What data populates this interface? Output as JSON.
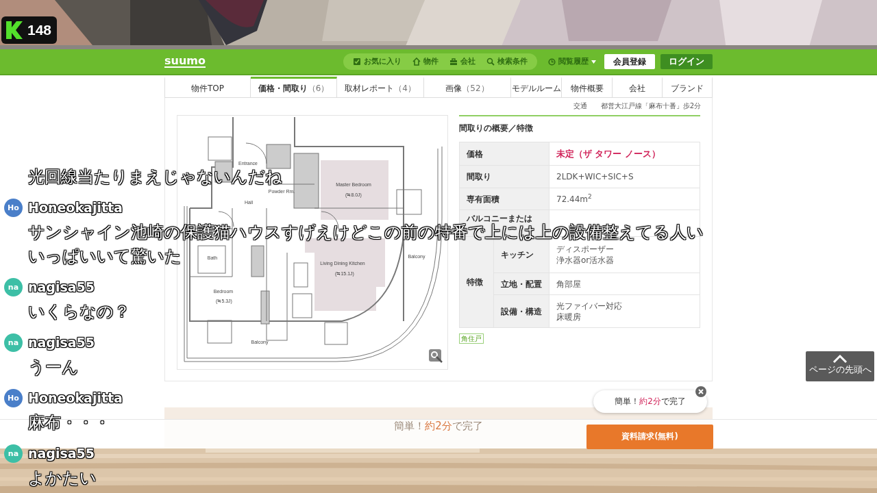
{
  "stream_badge": {
    "count": "148"
  },
  "header": {
    "logo": "suumo",
    "nav": [
      {
        "label": "お気に入り"
      },
      {
        "label": "物件"
      },
      {
        "label": "会社"
      },
      {
        "label": "検索条件"
      }
    ],
    "history": "閲覧履歴",
    "register": "会員登録",
    "login": "ログイン"
  },
  "tabs": [
    {
      "label": "物件TOP",
      "selected": false
    },
    {
      "label": "価格・間取り",
      "count": "（6）",
      "selected": true
    },
    {
      "label": "取材レポート",
      "count": "（4）",
      "selected": false
    },
    {
      "label": "画像",
      "count": "（52）",
      "selected": false
    },
    {
      "label": "モデルルーム",
      "selected": false
    },
    {
      "label": "物件概要",
      "selected": false
    },
    {
      "label": "会社",
      "selected": false
    },
    {
      "label": "ブランド",
      "selected": false
    }
  ],
  "transit": {
    "label": "交通",
    "value": "都営大江戸線「麻布十番」歩2分"
  },
  "floor_plan": {
    "labels": [
      "Master Bedroom",
      "(≒8.0J)",
      "Living Dining Kitchen",
      "(≒15.1J)",
      "Bedroom",
      "(≒5.3J)",
      "Balcony",
      "Balcony",
      "Entrance",
      "Hall",
      "Powder Rm.",
      "Bath"
    ]
  },
  "overview": {
    "title": "間取りの概要／特徴",
    "rows": [
      {
        "label": "価格",
        "value": "未定（ザ タワー ノース）",
        "highlight": true
      },
      {
        "label": "間取り",
        "value": "2LDK+WIC+SIC+S",
        "highlight": false
      },
      {
        "label": "専有面積",
        "value": "72.44m$^{2}$",
        "highlight": false
      },
      {
        "label": "バルコニーまたは"
      }
    ],
    "features": {
      "label": "特徴",
      "items": [
        {
          "label": "キッチン",
          "lines": [
            "ディスポーザー",
            "浄水器or活水器"
          ]
        },
        {
          "label": "立地・配置",
          "lines": [
            "角部屋"
          ]
        },
        {
          "label": "設備・構造",
          "lines": [
            "光ファイバー対応",
            "床暖房"
          ]
        }
      ]
    },
    "tags": [
      "角住戸"
    ]
  },
  "page_top": {
    "label": "ページの先頭へ"
  },
  "popup": {
    "prefix": "簡単！",
    "emphasis": "約2分",
    "suffix": "で完了"
  },
  "banner": {
    "prefix": "簡単！",
    "emphasis": "約2分",
    "suffix": "で完了"
  },
  "request_button": "資料請求(無料)",
  "chat": [
    {
      "lines": [
        "光回線当たりまえじゃないんだね"
      ]
    },
    {
      "user": "Honeokajitta",
      "avatar": "Ho",
      "color": "#4a7fc9",
      "lines": [
        "サンシャイン池崎の保護猫ハウスすげえけどこの前の特番で上には上の設備整えてる人い",
        "いっぱいいて驚いた"
      ]
    },
    {
      "user": "nagisa55",
      "avatar": "na",
      "color": "#3dbfa6",
      "lines": [
        "いくらなの？"
      ]
    },
    {
      "user": "nagisa55",
      "avatar": "na",
      "color": "#3dbfa6",
      "lines": [
        "うーん"
      ]
    },
    {
      "user": "Honeokajitta",
      "avatar": "Ho",
      "color": "#4a7fc9",
      "lines": [
        "麻布・・・"
      ]
    },
    {
      "user": "nagisa55",
      "avatar": "na",
      "color": "#3dbfa6",
      "lines": [
        "よかたい"
      ]
    }
  ]
}
